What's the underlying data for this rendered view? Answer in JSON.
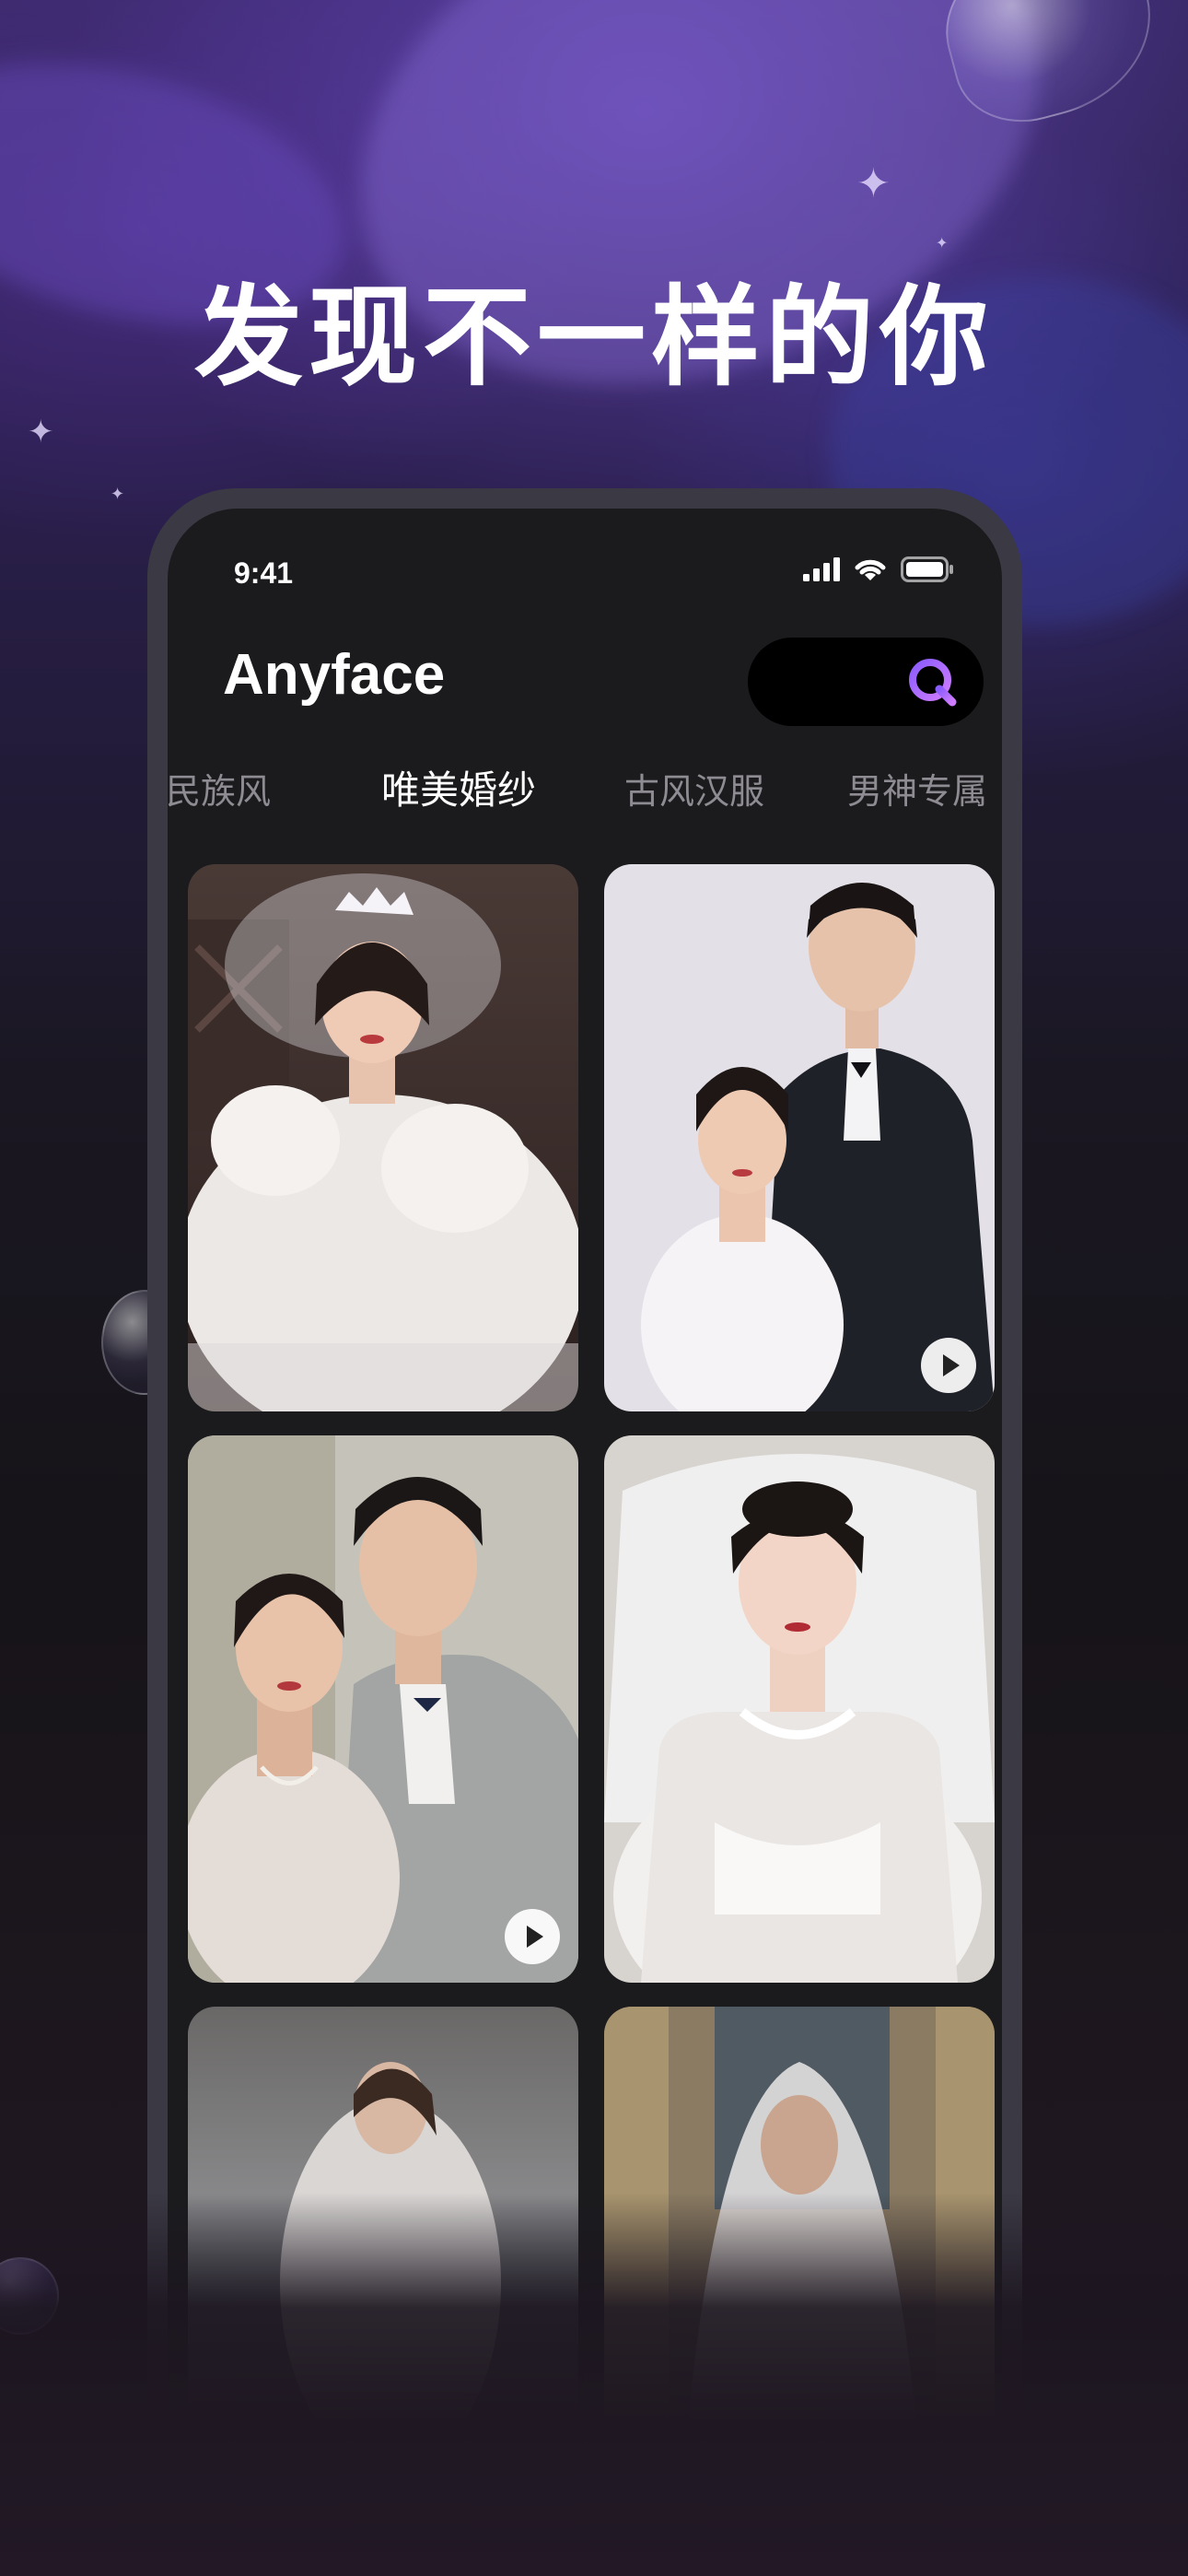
{
  "headline": "发现不一样的你",
  "status_bar": {
    "time": "9:41"
  },
  "app": {
    "title": "Anyface",
    "search_icon": "search-q-icon",
    "accent": "#a66cff"
  },
  "tabs": [
    {
      "label": "民族风",
      "active": false
    },
    {
      "label": "唯美婚纱",
      "active": true
    },
    {
      "label": "古风汉服",
      "active": false
    },
    {
      "label": "男神专属",
      "active": false
    }
  ],
  "cards": [
    {
      "name": "bride-veil-tiara-photo",
      "has_play": false
    },
    {
      "name": "couple-suit-wedding-photo",
      "has_play": true
    },
    {
      "name": "couple-embrace-photo",
      "has_play": true
    },
    {
      "name": "bride-pearl-necklace-photo",
      "has_play": false
    },
    {
      "name": "seaside-bride-photo",
      "has_play": false
    },
    {
      "name": "veiled-bride-photo",
      "has_play": false
    }
  ]
}
